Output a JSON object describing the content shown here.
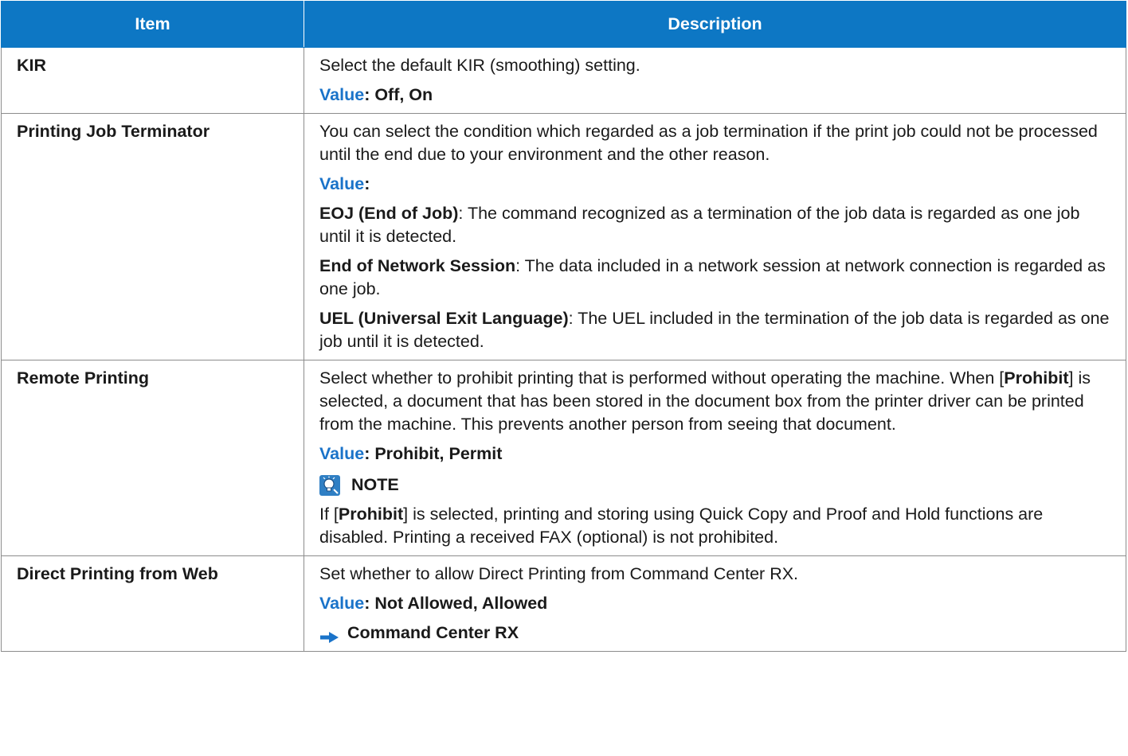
{
  "header": {
    "item": "Item",
    "description": "Description"
  },
  "rows": {
    "kir": {
      "item": "KIR",
      "text": "Select the default KIR (smoothing) setting.",
      "value_label": "Value",
      "value": ": Off, On"
    },
    "pjt": {
      "item": "Printing Job Terminator",
      "text": "You can select the condition which regarded as a job termination if the print job could not be processed until the end due to your environment and the other reason.",
      "value_label": "Value",
      "value": ":",
      "options": [
        {
          "name": "EOJ (End of Job)",
          "desc": ": The command recognized as a termination of the job data is regarded as one job until it is detected."
        },
        {
          "name": "End of Network Session",
          "desc": ": The data included in a network session at network connection is regarded as one job."
        },
        {
          "name": "UEL (Universal Exit Language)",
          "desc": ": The UEL included in the termination of the job data is regarded as one job until it is detected."
        }
      ]
    },
    "remote": {
      "item": "Remote Printing",
      "text_pre": "Select whether to prohibit printing that is performed without operating the machine. When [",
      "text_bold": "Prohibit",
      "text_post": "] is selected, a document that has been stored in the document box from the printer driver can be printed from the machine. This prevents another person from seeing that document.",
      "value_label": "Value",
      "value": ": Prohibit, Permit",
      "note_title": "NOTE",
      "note_pre": "If [",
      "note_bold": "Prohibit",
      "note_post": "] is selected, printing and storing using Quick Copy and Proof and Hold functions are disabled. Printing a received FAX (optional) is not prohibited."
    },
    "direct": {
      "item": "Direct Printing from Web",
      "text": "Set whether to allow Direct Printing from Command Center RX.",
      "value_label": "Value",
      "value": ": Not Allowed, Allowed",
      "link": "Command Center RX"
    }
  },
  "colors": {
    "header_bg": "#0d77c4",
    "value_label": "#1a73c9",
    "border": "#8c8c8c"
  }
}
